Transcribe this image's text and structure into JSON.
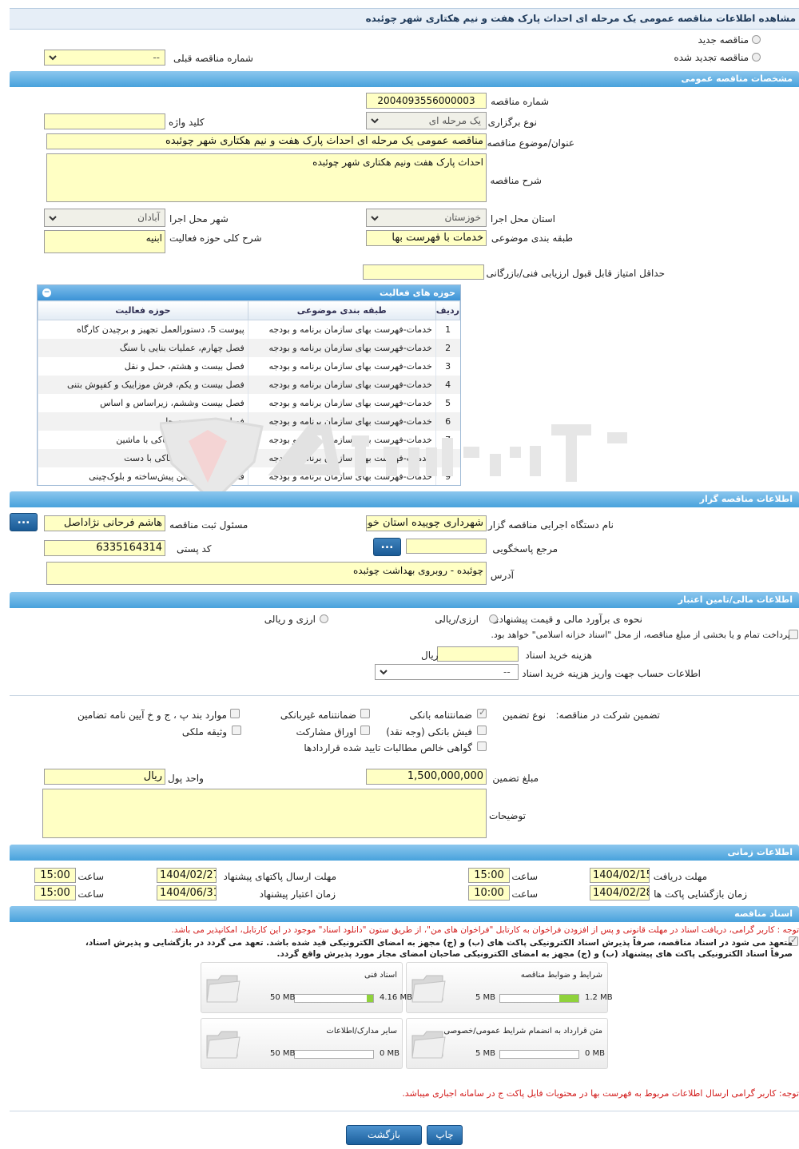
{
  "title": "مشاهده اطلاعات مناقصه عمومی یک مرحله ای احداث پارک هفت و نیم هکتاری شهر چوئبده",
  "tender_type": {
    "new_label": "مناقصه جدید",
    "renewed_label": "مناقصه تجدید شده",
    "prev_number_label": "شماره مناقصه قبلی",
    "prev_number_value": "--"
  },
  "general": {
    "header": "مشخصات مناقصه عمومی",
    "number_label": "شماره مناقصه",
    "number_value": "2004093556000003",
    "method_label": "نوع برگزاری",
    "method_value": "یک مرحله ای",
    "keyword_label": "کلید واژه",
    "keyword_value": "",
    "subject_label": "عنوان/موضوع مناقصه",
    "subject_value": "مناقصه عمومی یک مرحله ای احداث پارک هفت و نیم هکتاری شهر چوئبده",
    "desc_label": "شرح مناقصه",
    "desc_value": "احداث پارک هفت ونیم هکتاری شهر چوئبده",
    "province_label": "استان محل اجرا",
    "province_value": "خوزستان",
    "city_label": "شهر محل اجرا",
    "city_value": "آبادان",
    "category_label": "طبقه بندی موضوعی",
    "category_value": "خدمات با فهرست بها",
    "activity_desc_label": "شرح کلی حوزه فعالیت",
    "activity_desc_value": "ابنیه",
    "min_score_label": "حداقل امتیاز قابل قبول ارزیابی فنی/بازرگانی",
    "min_score_value": ""
  },
  "activity_grid": {
    "header": "حوزه های فعالیت",
    "toggle": "−",
    "columns": [
      "ردیف",
      "طبقه بندی موضوعی",
      "حوزه فعالیت"
    ],
    "rows": [
      [
        "1",
        "خدمات-فهرست بهای سازمان برنامه و بودجه",
        "پیوست 5، دستورالعمل تجهیز و برچیدن کارگاه"
      ],
      [
        "2",
        "خدمات-فهرست بهای سازمان برنامه و بودجه",
        "فصل چهارم، عملیات بنایی با سنگ"
      ],
      [
        "3",
        "خدمات-فهرست بهای سازمان برنامه و بودجه",
        "فصل بیست و هشتم، حمل و نقل"
      ],
      [
        "4",
        "خدمات-فهرست بهای سازمان برنامه و بودجه",
        "فصل بیست و یکم، فرش موزاییک و کفپوش بتنی"
      ],
      [
        "5",
        "خدمات-فهرست بهای سازمان برنامه و بودجه",
        "فصل بیست وششم، زیراساس و اساس"
      ],
      [
        "6",
        "خدمات-فهرست بهای سازمان برنامه و بودجه",
        "فصل هشتم، بتن درجا"
      ],
      [
        "7",
        "خدمات-فهرست بهای سازمان برنامه و بودجه",
        "فصل سوم، عملیات خاکی با ماشین"
      ],
      [
        "8",
        "خدمات-فهرست بهای سازمان برنامه و بودجه",
        "فصل دوم، عملیات خاکی با دست"
      ],
      [
        "9",
        "خدمات-فهرست بهای سازمان برنامه و بودجه",
        "فصل دوازدهم، بتن پیش‌ساخته و بلوک‌چینی"
      ]
    ]
  },
  "organizer": {
    "header": "اطلاعات مناقصه گزار",
    "org_label": "نام دستگاه اجرایی مناقصه گزار",
    "org_value": "شهرداری چوییده استان خوزستان",
    "registrar_label": "مسئول ثبت مناقصه",
    "registrar_value": "هاشم فرحانی نژاداصل",
    "ref_label": "مرجع پاسخگویی",
    "ref_value": "",
    "postal_label": "کد پستی",
    "postal_value": "6335164314",
    "address_label": "آدرس",
    "address_value": "چوئبده - روبروی بهداشت چوئبده",
    "dots": "..."
  },
  "finance": {
    "header": "اطلاعات مالی/تامین اعتبار",
    "estimate_label": "نحوه ی برآورد مالی و قیمت پیشنهادی",
    "opt_rial": "ارزی/ریالی",
    "opt_fx": "ارزی و ریالی",
    "treasury_text": "پرداخت تمام و یا بخشی از مبلغ مناقصه، از محل \"اسناد خزانه اسلامی\" خواهد بود.",
    "doc_fee_label": "هزینه خرید اسناد",
    "doc_fee_value": "",
    "doc_fee_unit": "ریال",
    "account_label": "اطلاعات حساب جهت واریز هزینه خرید اسناد",
    "account_value": "--"
  },
  "guarantee": {
    "label": "تضمین شرکت در مناقصه:",
    "type_label": "نوع تضمین",
    "options": [
      "ضمانتنامه بانکی",
      "ضمانتنامه غیربانکی",
      "موارد بند پ ، ج و خ آیین نامه تضامین",
      "فیش بانکی (وجه نقد)",
      "اوراق مشارکت",
      "وثیقه ملکی",
      "گواهی خالص مطالبات تایید شده قراردادها"
    ],
    "amount_label": "مبلغ تضمین",
    "amount_value": "1,500,000,000",
    "currency_label": "واحد پول",
    "currency_value": "ریال",
    "notes_label": "توضیحات",
    "notes_value": ""
  },
  "timing": {
    "header": "اطلاعات زمانی",
    "doc_receive_label": "مهلت دریافت اسناد",
    "doc_receive_date": "1404/02/15",
    "doc_receive_time": "15:00",
    "submit_label": "مهلت ارسال پاکتهای پیشنهاد",
    "submit_date": "1404/02/27",
    "submit_time": "15:00",
    "open_label": "زمان بازگشایی پاکت ها",
    "open_date": "1404/02/28",
    "open_time": "10:00",
    "validity_label": "زمان اعتبار پیشنهاد",
    "validity_date": "1404/06/31",
    "validity_time": "15:00",
    "time_label": "ساعت"
  },
  "documents": {
    "header": "اسناد مناقصه",
    "notice1": "توجه : کاربر گرامی، دریافت اسناد در مهلت قانونی و پس از افزودن فراخوان به کارتابل \"فراخوان های من\"، از طریق ستون \"دانلود اسناد\" موجود در این کارتابل، امکانپذیر می باشد.",
    "commit_line1": "متعهد می شود در اسناد مناقصه، صرفاً پذیرش اسناد الکترونیکی پاکت های (ب) و (ج) مجهز به امضای الکترونیکی قید شده باشد. تعهد می گردد در بازگشایی و پذیرش اسناد،",
    "commit_line2": "صرفاً اسناد الکترونیکی پاکت های پیشنهاد (ب) و (ج) مجهز به امضای الکترونیکی صاحبان امضای مجاز مورد پذیرش واقع گردد.",
    "files": [
      {
        "name": "شرایط و ضوابط مناقصه",
        "current": "1.2 MB",
        "max": "5 MB",
        "progress": 0.24
      },
      {
        "name": "اسناد فنی",
        "current": "4.16 MB",
        "max": "50 MB",
        "progress": 0.083
      },
      {
        "name": "متن قرارداد به انضمام شرایط عمومی/خصوصی",
        "current": "0 MB",
        "max": "5 MB",
        "progress": 0
      },
      {
        "name": "سایر مدارک/اطلاعات",
        "current": "0 MB",
        "max": "50 MB",
        "progress": 0
      }
    ],
    "notice2": "توجه: کاربر گرامی ارسال اطلاعات مربوط به فهرست بها در محتویات فایل پاکت ج در سامانه اجباری میباشد."
  },
  "actions": {
    "print": "چاپ",
    "back": "بازگشت"
  },
  "colors": {
    "input_bg": "#ffffc4",
    "header_blue": "#48a2dc",
    "button_blue": "#1b5f9c",
    "notice_red": "#d21c1c"
  }
}
